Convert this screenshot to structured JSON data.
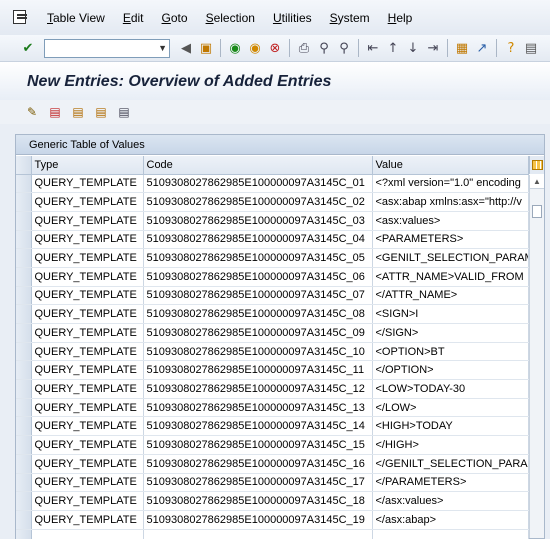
{
  "menu": [
    "Table View",
    "Edit",
    "Goto",
    "Selection",
    "Utilities",
    "System",
    "Help"
  ],
  "command_field": {
    "value": ""
  },
  "title": "New Entries: Overview of Added Entries",
  "panel_title": "Generic Table of Values",
  "columns": [
    "Type",
    "Code",
    "Value"
  ],
  "rows": [
    {
      "type": "QUERY_TEMPLATE",
      "code": "5109308027862985E100000097A3145C_01",
      "value": "<?xml version=\"1.0\" encoding"
    },
    {
      "type": "QUERY_TEMPLATE",
      "code": "5109308027862985E100000097A3145C_02",
      "value": "<asx:abap xmlns:asx=\"http://v"
    },
    {
      "type": "QUERY_TEMPLATE",
      "code": "5109308027862985E100000097A3145C_03",
      "value": "<asx:values>"
    },
    {
      "type": "QUERY_TEMPLATE",
      "code": "5109308027862985E100000097A3145C_04",
      "value": "<PARAMETERS>"
    },
    {
      "type": "QUERY_TEMPLATE",
      "code": "5109308027862985E100000097A3145C_05",
      "value": "<GENILT_SELECTION_PARAM"
    },
    {
      "type": "QUERY_TEMPLATE",
      "code": "5109308027862985E100000097A3145C_06",
      "value": "<ATTR_NAME>VALID_FROM"
    },
    {
      "type": "QUERY_TEMPLATE",
      "code": "5109308027862985E100000097A3145C_07",
      "value": "</ATTR_NAME>"
    },
    {
      "type": "QUERY_TEMPLATE",
      "code": "5109308027862985E100000097A3145C_08",
      "value": "<SIGN>I"
    },
    {
      "type": "QUERY_TEMPLATE",
      "code": "5109308027862985E100000097A3145C_09",
      "value": "</SIGN>"
    },
    {
      "type": "QUERY_TEMPLATE",
      "code": "5109308027862985E100000097A3145C_10",
      "value": "<OPTION>BT"
    },
    {
      "type": "QUERY_TEMPLATE",
      "code": "5109308027862985E100000097A3145C_11",
      "value": "</OPTION>"
    },
    {
      "type": "QUERY_TEMPLATE",
      "code": "5109308027862985E100000097A3145C_12",
      "value": "<LOW>TODAY-30"
    },
    {
      "type": "QUERY_TEMPLATE",
      "code": "5109308027862985E100000097A3145C_13",
      "value": "</LOW>"
    },
    {
      "type": "QUERY_TEMPLATE",
      "code": "5109308027862985E100000097A3145C_14",
      "value": "<HIGH>TODAY"
    },
    {
      "type": "QUERY_TEMPLATE",
      "code": "5109308027862985E100000097A3145C_15",
      "value": "</HIGH>"
    },
    {
      "type": "QUERY_TEMPLATE",
      "code": "5109308027862985E100000097A3145C_16",
      "value": "</GENILT_SELECTION_PARAM"
    },
    {
      "type": "QUERY_TEMPLATE",
      "code": "5109308027862985E100000097A3145C_17",
      "value": "</PARAMETERS>"
    },
    {
      "type": "QUERY_TEMPLATE",
      "code": "5109308027862985E100000097A3145C_18",
      "value": "</asx:values>"
    },
    {
      "type": "QUERY_TEMPLATE",
      "code": "5109308027862985E100000097A3145C_19",
      "value": "</asx:abap>"
    }
  ],
  "icons": {
    "toolbar": [
      "enter-check-icon",
      "back-icon",
      "save-icon",
      "back-green-icon",
      "exit-icon",
      "cancel-icon",
      "print-icon",
      "find-icon",
      "find-next-icon",
      "first-page-icon",
      "previous-page-icon",
      "next-page-icon",
      "last-page-icon",
      "create-session-icon",
      "shortcut-icon",
      "help-icon",
      "customize-layout-icon"
    ],
    "app_toolbar": [
      "edit-pencil-icon",
      "delete-entry-icon",
      "copy-entry-icon",
      "save-entry-icon",
      "details-icon"
    ]
  }
}
